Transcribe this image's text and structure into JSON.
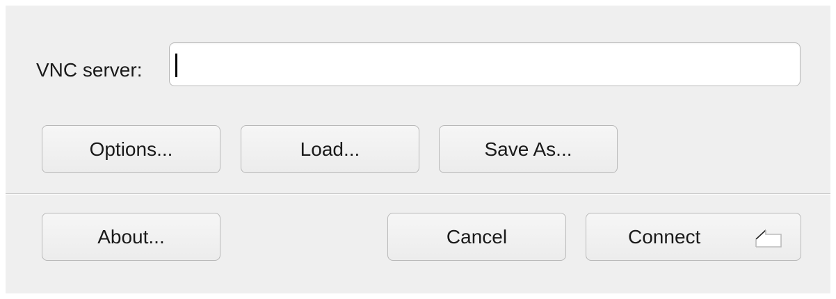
{
  "dialog": {
    "server_label": "VNC server:",
    "server_value": ""
  },
  "buttons": {
    "options": "Options...",
    "load": "Load...",
    "save_as": "Save As...",
    "about": "About...",
    "cancel": "Cancel",
    "connect": "Connect"
  },
  "icons": {
    "connect_shortcut": "return-key-icon"
  }
}
